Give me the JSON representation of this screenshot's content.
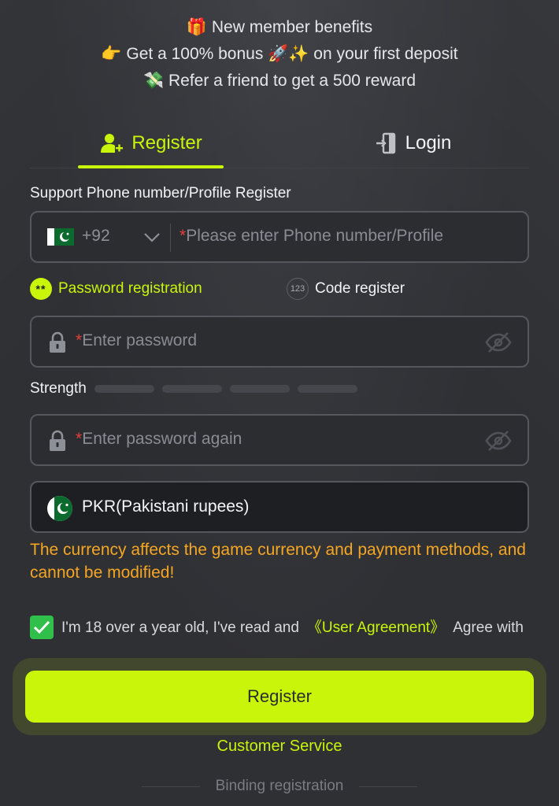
{
  "benefits": {
    "line1": "🎁 New member benefits",
    "line2": "👉 Get a 100% bonus 🚀✨ on your first deposit",
    "line3": "💸 Refer a friend to get a 500 reward"
  },
  "tabs": {
    "register": {
      "label": "Register",
      "icon": "add-user-icon",
      "active": true
    },
    "login": {
      "label": "Login",
      "icon": "login-door-icon",
      "active": false
    }
  },
  "phone": {
    "section_label": "Support Phone number/Profile Register",
    "country_code": "+92",
    "required_mark": "*",
    "placeholder": "Please enter Phone number/Profile"
  },
  "registration_modes": {
    "password": {
      "icon_text": "**",
      "label": "Password registration",
      "selected": true
    },
    "code": {
      "icon_text": "123",
      "label": "Code register",
      "selected": false
    }
  },
  "password": {
    "required_mark": "*",
    "placeholder": "Enter password"
  },
  "strength": {
    "label": "Strength",
    "level": 0,
    "segments": 4
  },
  "password_again": {
    "required_mark": "*",
    "placeholder": "Enter password again"
  },
  "currency": {
    "label": "PKR(Pakistani rupees)",
    "flag_icon": "pakistan-flag-icon"
  },
  "warning": "The currency affects the game currency and payment methods, and cannot be modified!",
  "agreement": {
    "checked": true,
    "text_before": "I'm 18 over a year old, I've read and",
    "link": "《User Agreement》",
    "text_after": "Agree with"
  },
  "register_button": "Register",
  "customer_service": "Customer Service",
  "binding_registration": "Binding registration",
  "colors": {
    "accent": "#c9f50a",
    "background": "#2f3034",
    "warning": "#f5a623",
    "required": "#e2413b",
    "check": "#2fbf4a"
  }
}
